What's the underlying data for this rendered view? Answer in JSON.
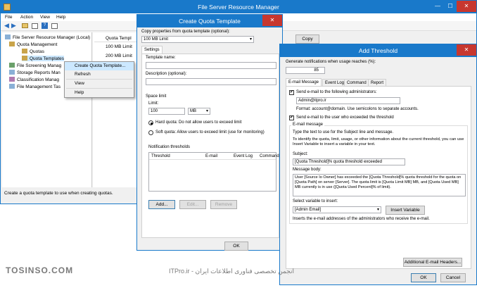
{
  "main": {
    "title": "File Server Resource Manager",
    "menu": [
      "File",
      "Action",
      "View",
      "Help"
    ],
    "tree": [
      "File Server Resource Manager (Local)",
      "Quota Management",
      "Quotas",
      "Quota Templates",
      "File Screening Manag",
      "Storage Reports Man",
      "Classification Manag",
      "File Management Tas"
    ],
    "list_header": "Quota Templ",
    "list_items": [
      "100 MB Limit",
      "200 MB Limit"
    ],
    "status": "Create a quota template to use when creating quotas."
  },
  "context_menu": [
    "Create Quota Template...",
    "Refresh",
    "View",
    "Help"
  ],
  "create": {
    "title": "Create Quota Template",
    "copy_label": "Copy properties from quota template (optional):",
    "copy_value": "100 MB Limit",
    "copy_button": "Copy",
    "tab": "Settings",
    "template_name_label": "Template name:",
    "description_label": "Description (optional):",
    "space_limit": "Space limit",
    "limit_label": "Limit:",
    "limit_value": "100",
    "limit_unit": "MB",
    "hard_quota": "Hard quota: Do not allow users to exceed limit",
    "soft_quota": "Soft quota: Allow users to exceed limit (use for monitoring)",
    "notification": "Notification thresholds",
    "columns": [
      "Threshold",
      "E-mail",
      "Event Log",
      "Command"
    ],
    "add": "Add...",
    "edit": "Edit...",
    "remove": "Remove",
    "ok": "OK"
  },
  "threshold": {
    "title": "Add Threshold",
    "gen_label": "Generate notifications when usage reaches (%):",
    "gen_value": "85",
    "tabs": [
      "E-mail Message",
      "Event Log",
      "Command",
      "Report"
    ],
    "send_admins": "Send e-mail to the following administrators:",
    "admin_value": "Admin@itpro.ir",
    "format": "Format: account@domain. Use semicolons to separate accounts.",
    "send_user": "Send e-mail to the user who exceeded the threshold",
    "email_message": "E-mail message",
    "type_text": "Type the text to use for the Subject line and message.",
    "identify_text": "To identify the quota, limit, usage, or other information about the current threshold, you can use Insert Variable to insert a variable in your text.",
    "subject_label": "Subject:",
    "subject_value": "[Quota Threshold]% quota threshold exceeded",
    "body_label": "Message body:",
    "body_value": "User [Source Io Owner] has exceeded the [Quota Threshold]% quota threshold for the quota on [Quota Path] on server [Server]. The quota limit is [Quota Limit MB] MB, and [Quota Used MB] MB currently is in use ([Quota Used Percent]% of limit).",
    "select_var_label": "Select variable to insert:",
    "select_var_value": "[Admin Email]",
    "insert_var": "Insert Variable",
    "var_desc": "Inserts the e-mail addresses of the administrators who receive the e-mail.",
    "additional": "Additional E-mail Headers...",
    "ok": "OK",
    "cancel": "Cancel"
  },
  "watermark": {
    "left": "TOSINSO.COM",
    "right": "ITPro.ir - انجمن تخصصی فناوری اطلاعات ایران"
  }
}
